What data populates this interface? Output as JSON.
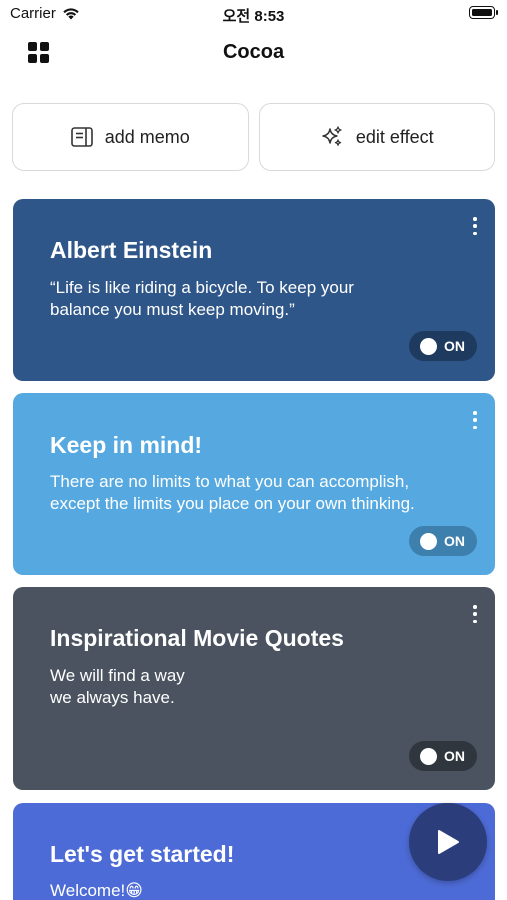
{
  "status_bar": {
    "carrier": "Carrier",
    "time": "오전 8:53"
  },
  "nav": {
    "title": "Cocoa",
    "menu_icon": "grid-icon"
  },
  "actions": {
    "add_memo": {
      "label": "add memo",
      "icon": "memo-icon"
    },
    "edit_effect": {
      "label": "edit effect",
      "icon": "sparkles-icon"
    }
  },
  "cards": [
    {
      "title": "Albert Einstein",
      "body": "“Life is like riding a bicycle. To keep your\nbalance you must keep moving.”",
      "toggle": "ON",
      "color": "#2f5689",
      "toggle_bg": "#1f3a5f"
    },
    {
      "title": "Keep in mind!",
      "body": "There are no limits to what you can accomplish,\nexcept the limits you place on your own thinking.",
      "toggle": "ON",
      "color": "#56a9e0",
      "toggle_bg": "#3d7fad"
    },
    {
      "title": "Inspirational Movie Quotes",
      "body": "We will find a way\nwe always have.",
      "toggle": "ON",
      "color": "#4a535f",
      "toggle_bg": "#2f363e"
    },
    {
      "title": "Let's get started!",
      "body": "Welcome!😁",
      "color": "#4d6bd6"
    }
  ],
  "fab": {
    "icon": "play-icon"
  }
}
